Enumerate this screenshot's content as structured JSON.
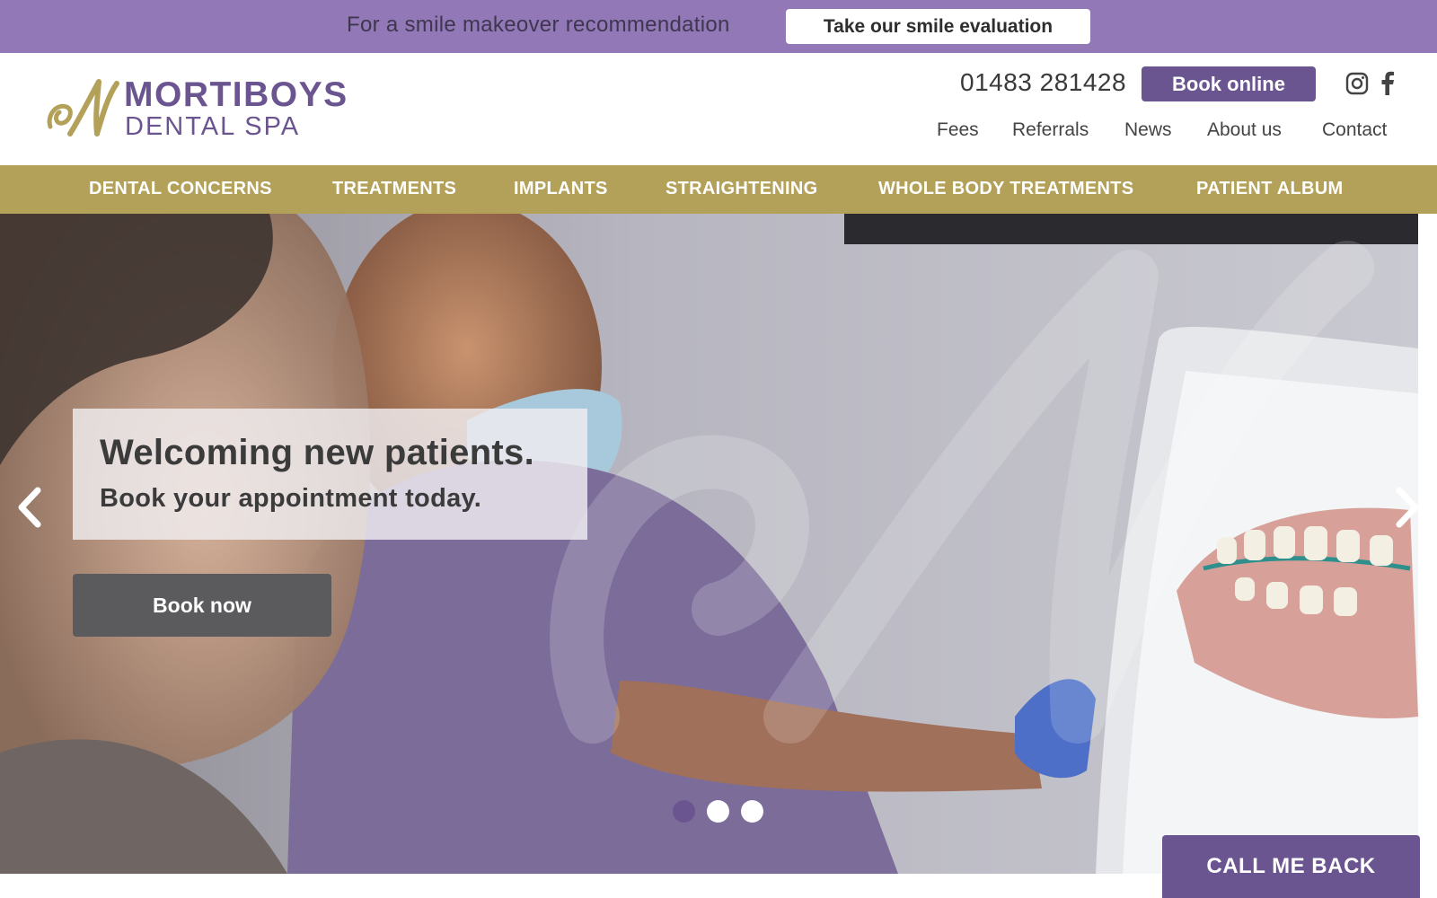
{
  "promo": {
    "text": "For a smile makeover recommendation",
    "button_label": "Take our smile evaluation"
  },
  "header": {
    "logo": {
      "name": "MORTIBOYS",
      "subtitle": "DENTAL SPA"
    },
    "phone": "01483 281428",
    "book_online_label": "Book online",
    "social": [
      "instagram-icon",
      "facebook-icon"
    ],
    "util_nav": [
      "Fees",
      "Referrals",
      "News",
      "About us",
      "Contact"
    ]
  },
  "main_nav": [
    "DENTAL CONCERNS",
    "TREATMENTS",
    "IMPLANTS",
    "STRAIGHTENING",
    "WHOLE BODY TREATMENTS",
    "PATIENT ALBUM"
  ],
  "hero": {
    "title": "Welcoming new patients.",
    "subtitle": "Book your appointment today.",
    "button_label": "Book now",
    "slides": 3,
    "active_slide": 1
  },
  "callback_label": "CALL ME BACK",
  "colors": {
    "brand_purple": "#6b5590",
    "promo_purple": "#9278b6",
    "nav_gold": "#b3a159",
    "button_grey": "#5b5a5c"
  }
}
